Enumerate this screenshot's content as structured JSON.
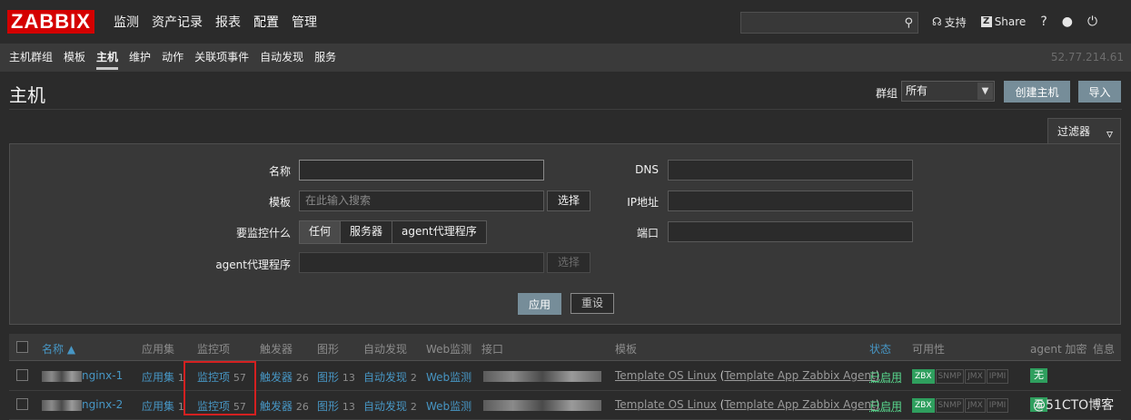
{
  "app": {
    "logo": "ZABBIX"
  },
  "main_menu": [
    "监测",
    "资产记录",
    "报表",
    "配置",
    "管理"
  ],
  "top_right": {
    "support": "支持",
    "share": "Share",
    "help": "?"
  },
  "sub_menu": [
    "主机群组",
    "模板",
    "主机",
    "维护",
    "动作",
    "关联项事件",
    "自动发现",
    "服务"
  ],
  "server_ip": "52.77.214.61",
  "page": {
    "title": "主机",
    "group_label": "群组",
    "group_value": "所有",
    "create_host": "创建主机",
    "import": "导入"
  },
  "filter": {
    "tab_label": "过滤器",
    "name_label": "名称",
    "template_label": "模板",
    "template_placeholder": "在此输入搜索",
    "select_button": "选择",
    "monitor_label": "要监控什么",
    "monitor_options": [
      "任何",
      "服务器",
      "agent代理程序"
    ],
    "proxy_label": "agent代理程序",
    "proxy_select": "选择",
    "dns_label": "DNS",
    "ip_label": "IP地址",
    "port_label": "端口",
    "apply": "应用",
    "reset": "重设"
  },
  "table": {
    "headers": {
      "name": "名称 ▲",
      "apps": "应用集",
      "items": "监控项",
      "triggers": "触发器",
      "graphs": "图形",
      "discovery": "自动发现",
      "web": "Web监测",
      "interface": "接口",
      "templates": "模板",
      "status": "状态",
      "availability": "可用性",
      "encryption": "agent 加密",
      "info": "信息"
    },
    "rows": [
      {
        "name": "nginx-1",
        "apps": "应用集",
        "apps_count": "1",
        "items": "监控项",
        "items_count": "57",
        "triggers": "触发器",
        "triggers_count": "26",
        "graphs": "图形",
        "graphs_count": "13",
        "discovery": "自动发现",
        "discovery_count": "2",
        "web": "Web监测",
        "template_main": "Template OS Linux",
        "template_sub": "Template App Zabbix Agent",
        "status": "已启用",
        "encryption": "无"
      },
      {
        "name": "nginx-2",
        "apps": "应用集",
        "apps_count": "1",
        "items": "监控项",
        "items_count": "57",
        "triggers": "触发器",
        "triggers_count": "26",
        "graphs": "图形",
        "graphs_count": "13",
        "discovery": "自动发现",
        "discovery_count": "2",
        "web": "Web监测",
        "template_main": "Template OS Linux",
        "template_sub": "Template App Zabbix Agent",
        "status": "已启用",
        "encryption": "无"
      }
    ],
    "availability_tags": [
      "ZBX",
      "SNMP",
      "JMX",
      "IPMI"
    ]
  },
  "watermark": "@51CTO博客",
  "colors": {
    "logo_red": "#d40000",
    "link_blue": "#4796c4",
    "enabled_green": "#59db8f",
    "zbx_green": "#2f9f5e",
    "button": "#768d99",
    "highlight_red": "#d42020"
  }
}
